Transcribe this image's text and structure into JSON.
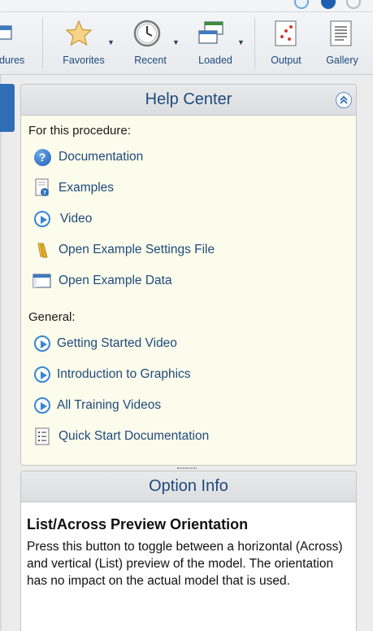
{
  "toolbar": {
    "buttons": [
      {
        "label": "dures",
        "icon": "procedures-icon"
      },
      {
        "label": "Favorites",
        "icon": "star-icon"
      },
      {
        "label": "Recent",
        "icon": "clock-icon"
      },
      {
        "label": "Loaded",
        "icon": "windows-icon"
      },
      {
        "label": "Output",
        "icon": "output-chart-icon"
      },
      {
        "label": "Gallery",
        "icon": "gallery-doc-icon"
      }
    ]
  },
  "help_center": {
    "title": "Help Center",
    "procedure_heading": "For this procedure:",
    "procedure_links": [
      {
        "label": "Documentation",
        "icon": "question-icon"
      },
      {
        "label": "Examples",
        "icon": "example-doc-icon"
      },
      {
        "label": "Video",
        "icon": "play-icon"
      },
      {
        "label": "Open Example Settings File",
        "icon": "folder-icon"
      },
      {
        "label": "Open Example Data",
        "icon": "data-sheet-icon"
      }
    ],
    "general_heading": "General:",
    "general_links": [
      {
        "label": "Getting Started Video",
        "icon": "play-icon"
      },
      {
        "label": "Introduction to Graphics",
        "icon": "play-icon"
      },
      {
        "label": "All Training Videos",
        "icon": "play-icon"
      },
      {
        "label": "Quick Start Documentation",
        "icon": "list-doc-icon"
      }
    ]
  },
  "option_info": {
    "title": "Option Info",
    "heading": "List/Across Preview Orientation",
    "body": "Press this button to toggle between a horizontal (Across) and vertical (List) preview of the model. The orientation has no impact on the actual model that is used."
  },
  "colors": {
    "link": "#1f4a7c",
    "panel_bg": "#fcfcec",
    "accent": "#2f6eb7"
  }
}
